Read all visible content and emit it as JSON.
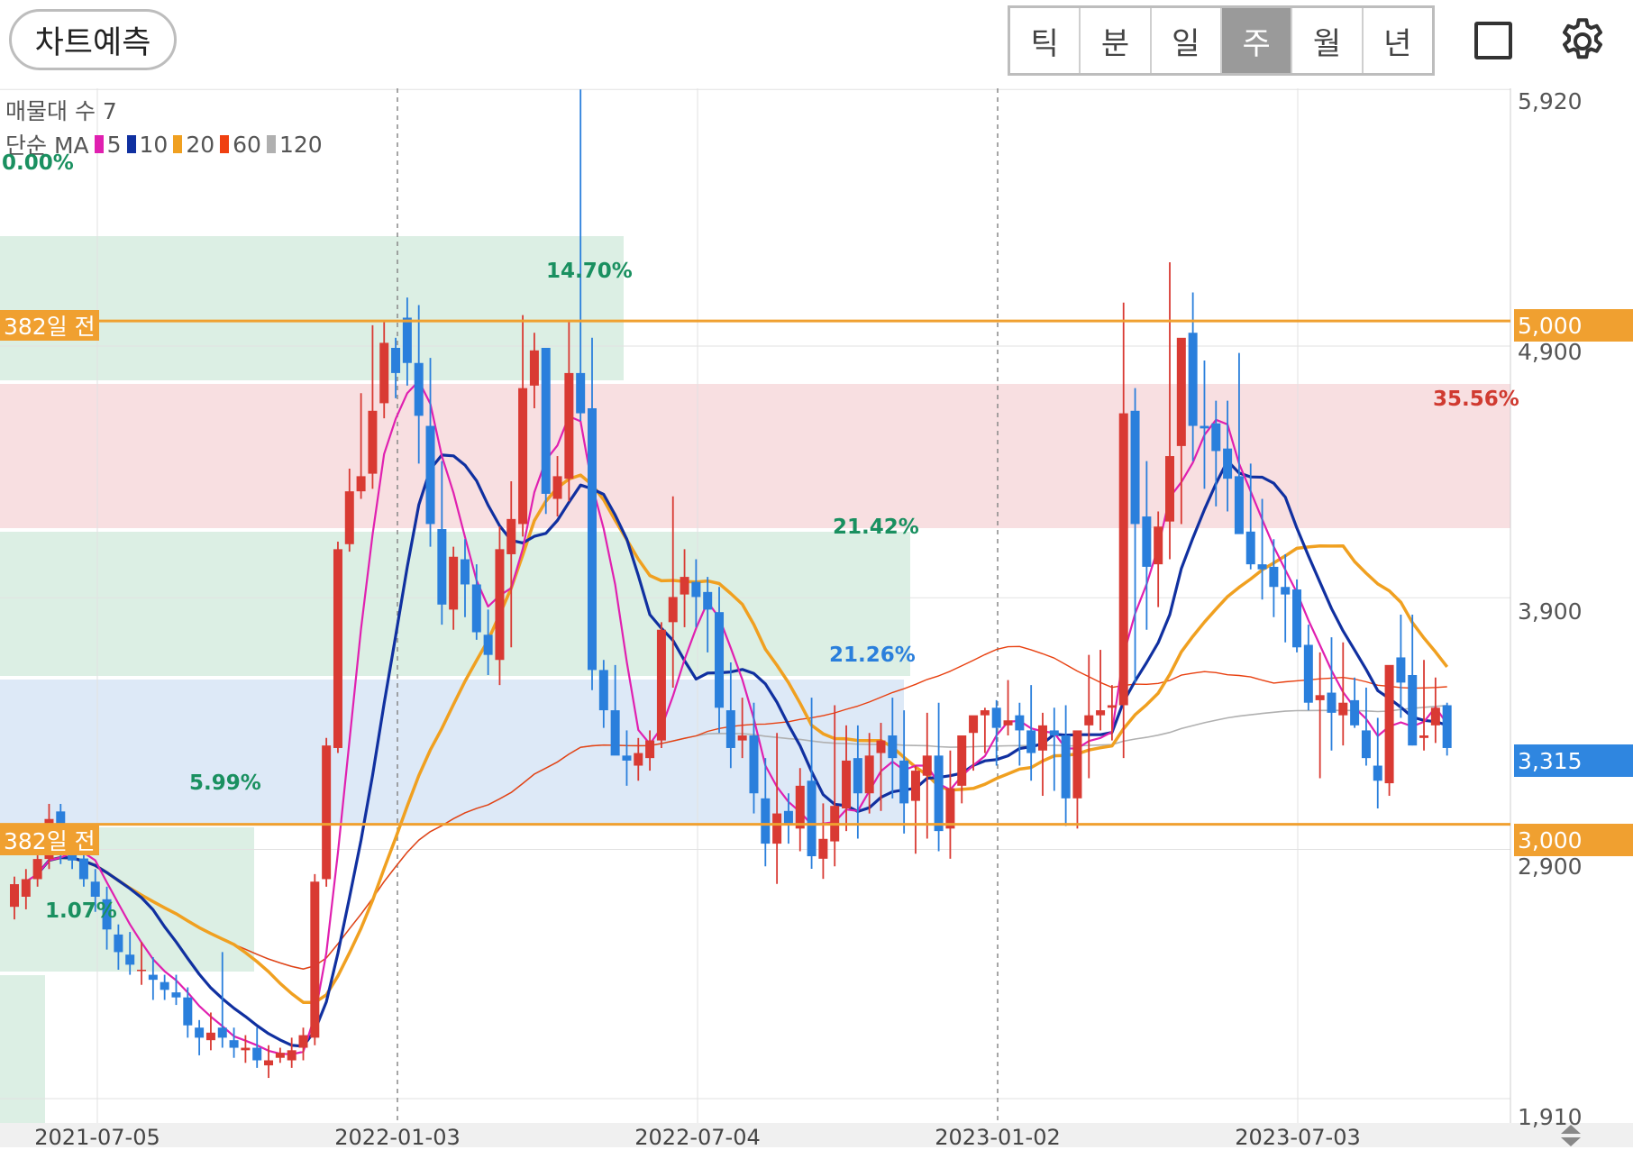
{
  "toolbar": {
    "predict_label": "차트예측",
    "periods": [
      "틱",
      "분",
      "일",
      "주",
      "월",
      "년"
    ],
    "active_period": "주"
  },
  "legend": {
    "volume_profile": "매물대 수 7",
    "ma_label": "단순 MA",
    "ma": [
      {
        "period": "5",
        "color": "#e020b0"
      },
      {
        "period": "10",
        "color": "#1030a0"
      },
      {
        "period": "20",
        "color": "#f0a020"
      },
      {
        "period": "60",
        "color": "#f04010"
      },
      {
        "period": "120",
        "color": "#b0b0b0"
      }
    ],
    "top_percent": "0.00%"
  },
  "y_axis": [
    "5,920",
    "4,900",
    "3,900",
    "2,900",
    "1,910"
  ],
  "x_axis": [
    "2021-07-05",
    "2022-01-03",
    "2022-07-04",
    "2023-01-02",
    "2023-07-03"
  ],
  "levels": [
    {
      "label": "382일 전",
      "price": "5,000"
    },
    {
      "label": "382일 전",
      "price": "3,000"
    }
  ],
  "current_price": "3,315",
  "zone_labels": [
    "14.70%",
    "35.56%",
    "21.42%",
    "21.26%",
    "5.99%",
    "1.07%"
  ],
  "colors": {
    "up": "#d93a33",
    "down": "#2a7fdc",
    "level": "#f0a030",
    "zone_green": "#dcefe4",
    "zone_red": "#f8dfe1",
    "zone_blue": "#dde9f7"
  },
  "chart_data": {
    "type": "candlestick",
    "x": [
      "2021-06-07",
      "2021-06-14",
      "2021-06-21",
      "2021-06-28",
      "2021-07-05",
      "2021-07-12",
      "2021-07-19",
      "2021-07-26",
      "2021-08-02",
      "2021-08-09",
      "2021-08-16",
      "2021-08-23",
      "2021-08-30",
      "2021-09-06",
      "2021-09-13",
      "2021-09-20",
      "2021-09-27",
      "2021-10-04",
      "2021-10-11",
      "2021-10-18",
      "2021-10-25",
      "2021-11-01",
      "2021-11-08",
      "2021-11-15",
      "2021-11-22",
      "2021-11-29",
      "2021-12-06",
      "2021-12-13",
      "2021-12-20",
      "2021-12-27",
      "2022-01-03",
      "2022-01-10",
      "2022-01-17",
      "2022-01-24",
      "2022-01-31",
      "2022-02-07",
      "2022-02-14",
      "2022-02-21",
      "2022-02-28",
      "2022-03-07",
      "2022-03-14",
      "2022-03-21",
      "2022-03-28",
      "2022-04-04",
      "2022-04-11",
      "2022-04-18",
      "2022-04-25",
      "2022-05-02",
      "2022-05-09",
      "2022-05-16",
      "2022-05-23",
      "2022-05-30",
      "2022-06-06",
      "2022-06-13",
      "2022-06-20",
      "2022-06-27",
      "2022-07-04",
      "2022-07-11",
      "2022-07-18",
      "2022-07-25",
      "2022-08-01",
      "2022-08-08",
      "2022-08-15",
      "2022-08-22",
      "2022-08-29",
      "2022-09-05",
      "2022-09-12",
      "2022-09-19",
      "2022-09-26",
      "2022-10-03",
      "2022-10-10",
      "2022-10-17",
      "2022-10-24",
      "2022-10-31",
      "2022-11-07",
      "2022-11-14",
      "2022-11-21",
      "2022-11-28",
      "2022-12-05",
      "2022-12-12",
      "2022-12-19",
      "2022-12-26",
      "2023-01-02",
      "2023-01-09",
      "2023-01-16",
      "2023-01-23",
      "2023-01-30",
      "2023-02-06",
      "2023-02-13",
      "2023-02-20",
      "2023-02-27",
      "2023-03-06",
      "2023-03-13",
      "2023-03-20",
      "2023-03-27",
      "2023-04-03",
      "2023-04-10",
      "2023-04-17",
      "2023-04-24",
      "2023-05-01",
      "2023-05-08",
      "2023-05-15",
      "2023-05-22",
      "2023-05-29",
      "2023-06-05",
      "2023-06-12",
      "2023-06-19",
      "2023-06-26",
      "2023-07-03",
      "2023-07-10",
      "2023-07-17",
      "2023-07-24",
      "2023-07-31",
      "2023-08-07",
      "2023-08-14",
      "2023-08-21",
      "2023-08-28",
      "2023-09-04",
      "2023-09-11",
      "2023-09-18",
      "2023-09-25",
      "2023-10-02",
      "2023-10-09",
      "2023-10-16",
      "2023-10-23"
    ],
    "open": [
      2672,
      2712,
      2782,
      2862,
      3051,
      2896,
      2864,
      2772,
      2702,
      2562,
      2482,
      2422,
      2402,
      2373,
      2332,
      2312,
      2192,
      2142,
      2192,
      2142,
      2102,
      2112,
      2042,
      2072,
      2062,
      2112,
      2152,
      2782,
      3303,
      4113,
      4323,
      4393,
      4673,
      4893,
      5013,
      4833,
      4583,
      4173,
      3853,
      4053,
      3953,
      3753,
      3653,
      4073,
      4193,
      4743,
      4893,
      4293,
      4373,
      4793,
      4653,
      3613,
      3453,
      3273,
      3233,
      3263,
      3333,
      3803,
      3913,
      3963,
      3923,
      3843,
      3453,
      3333,
      3353,
      3103,
      2923,
      3053,
      2983,
      3173,
      2863,
      2932,
      3063,
      3263,
      3123,
      3283,
      3353,
      3253,
      3093,
      3193,
      3273,
      2983,
      3153,
      3363,
      3433,
      3463,
      3393,
      3433,
      3373,
      3293,
      3373,
      3353,
      3103,
      3393,
      3433,
      3463,
      3473,
      4643,
      4223,
      4033,
      4203,
      4503,
      4953,
      4583,
      4593,
      4493,
      4383,
      4163,
      4033,
      4023,
      3943,
      3933,
      3713,
      3493,
      3523,
      3433,
      3493,
      3373,
      3233,
      3163,
      3663,
      3593,
      3343,
      3393,
      3473
    ],
    "close": [
      2762,
      2782,
      2862,
      3021,
      2912,
      2856,
      2782,
      2712,
      2582,
      2492,
      2442,
      2422,
      2382,
      2342,
      2312,
      2201,
      2152,
      2172,
      2152,
      2112,
      2112,
      2062,
      2062,
      2092,
      2102,
      2162,
      2772,
      3313,
      4093,
      4323,
      4383,
      4643,
      4913,
      4793,
      4833,
      4623,
      4193,
      3873,
      4063,
      3953,
      3763,
      3673,
      4093,
      4213,
      4733,
      4883,
      4313,
      4383,
      4793,
      4633,
      3613,
      3453,
      3273,
      3253,
      3283,
      3333,
      3773,
      3903,
      3983,
      3903,
      3853,
      3463,
      3303,
      3353,
      3123,
      2923,
      3043,
      3003,
      3153,
      2873,
      2942,
      3073,
      3253,
      3123,
      3273,
      3333,
      3263,
      3083,
      3213,
      3273,
      2973,
      3143,
      3353,
      3433,
      3453,
      3383,
      3413,
      3373,
      3283,
      3393,
      3353,
      3103,
      3373,
      3433,
      3453,
      3473,
      4633,
      4193,
      4023,
      4183,
      4463,
      4933,
      4583,
      4573,
      4483,
      4373,
      4153,
      4033,
      4013,
      3943,
      3913,
      3703,
      3483,
      3513,
      3443,
      3483,
      3393,
      3263,
      3173,
      3633,
      3563,
      3313,
      3353,
      3463,
      3303
    ],
    "high": [
      2792,
      2822,
      2902,
      3081,
      3081,
      2972,
      2912,
      2822,
      2752,
      2602,
      2572,
      2532,
      2472,
      2402,
      2402,
      2352,
      2222,
      2252,
      2492,
      2192,
      2162,
      2192,
      2122,
      2112,
      2152,
      2192,
      2802,
      3343,
      4123,
      4413,
      4713,
      4983,
      5003,
      4933,
      5093,
      5063,
      4853,
      4443,
      4103,
      4133,
      4033,
      3853,
      4183,
      4363,
      5023,
      4953,
      4633,
      4463,
      5003,
      5920,
      4933,
      3653,
      3633,
      3373,
      3343,
      3373,
      3803,
      4303,
      4093,
      4053,
      3983,
      3943,
      3643,
      3503,
      3483,
      3263,
      3363,
      3123,
      3223,
      3503,
      3083,
      3473,
      3393,
      3393,
      3363,
      3403,
      3503,
      3453,
      3233,
      3443,
      3483,
      3293,
      3313,
      3383,
      3463,
      3493,
      3573,
      3483,
      3553,
      3443,
      3463,
      3473,
      3303,
      3673,
      3693,
      3553,
      5073,
      4733,
      4443,
      4243,
      5233,
      4903,
      5113,
      4843,
      4683,
      4683,
      4873,
      4433,
      4293,
      4133,
      4073,
      3973,
      3793,
      3683,
      3743,
      3723,
      3583,
      3543,
      3423,
      3323,
      3833,
      3833,
      3653,
      3583,
      3483
    ],
    "low": [
      2622,
      2662,
      2752,
      2822,
      2842,
      2822,
      2752,
      2652,
      2502,
      2422,
      2402,
      2362,
      2302,
      2302,
      2282,
      2152,
      2082,
      2102,
      2112,
      2072,
      2052,
      2032,
      1992,
      2052,
      2032,
      2062,
      2122,
      2752,
      3283,
      4083,
      4293,
      4333,
      4613,
      4693,
      4743,
      4433,
      4103,
      3793,
      3773,
      3823,
      3733,
      3593,
      3553,
      3703,
      4143,
      4653,
      4233,
      4223,
      4283,
      4603,
      3533,
      3383,
      3293,
      3153,
      3173,
      3213,
      3303,
      3543,
      3783,
      3783,
      3683,
      3363,
      3223,
      3263,
      3043,
      2833,
      2763,
      2923,
      2893,
      2823,
      2783,
      2833,
      2973,
      2943,
      3043,
      3053,
      3103,
      2963,
      2883,
      2943,
      2893,
      2863,
      3083,
      3213,
      3283,
      3233,
      3353,
      3233,
      3173,
      3113,
      3133,
      2993,
      2983,
      3183,
      3373,
      3333,
      3263,
      3563,
      3773,
      3863,
      4053,
      4193,
      4443,
      4333,
      4263,
      4243,
      4273,
      4013,
      3893,
      3823,
      3723,
      3683,
      3453,
      3183,
      3293,
      3313,
      3383,
      3233,
      3063,
      3113,
      3423,
      3313,
      3293,
      3323,
      3273
    ]
  }
}
